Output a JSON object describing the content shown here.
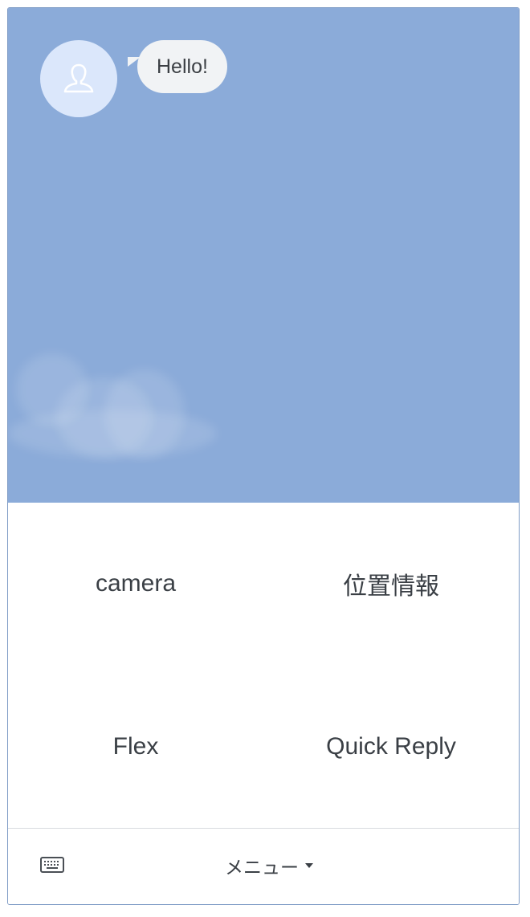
{
  "chat": {
    "background_color": "#8babd9",
    "messages": [
      {
        "sender": "bot",
        "avatar_icon": "user-icon",
        "text": "Hello!"
      }
    ]
  },
  "rich_menu": {
    "items": [
      {
        "label": "camera"
      },
      {
        "label": "位置情報"
      },
      {
        "label": "Flex"
      },
      {
        "label": "Quick Reply"
      }
    ]
  },
  "footer": {
    "keyboard_icon": "keyboard-icon",
    "menu_label": "メニュー",
    "menu_caret_icon": "caret-down-icon"
  }
}
